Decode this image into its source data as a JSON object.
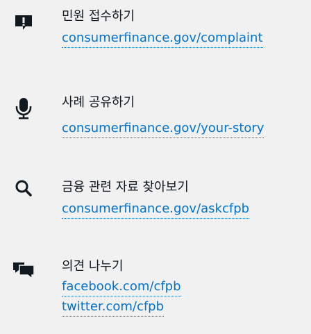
{
  "items": [
    {
      "icon": "complaint-icon",
      "title": "민원 접수하기",
      "links": [
        "consumerfinance.gov/complaint"
      ]
    },
    {
      "icon": "microphone-icon",
      "title": "사례 공유하기",
      "links": [
        "consumerfinance.gov/your-story"
      ]
    },
    {
      "icon": "search-icon",
      "title": "금융 관련 자료 찾아보기",
      "links": [
        "consumerfinance.gov/askcfpb"
      ]
    },
    {
      "icon": "chat-bubbles-icon",
      "title": "의견 나누기",
      "links": [
        "facebook.com/cfpb",
        "twitter.com/cfpb"
      ]
    }
  ],
  "colors": {
    "background": "#f1f1f1",
    "text": "#101820",
    "link": "#0072ce"
  }
}
